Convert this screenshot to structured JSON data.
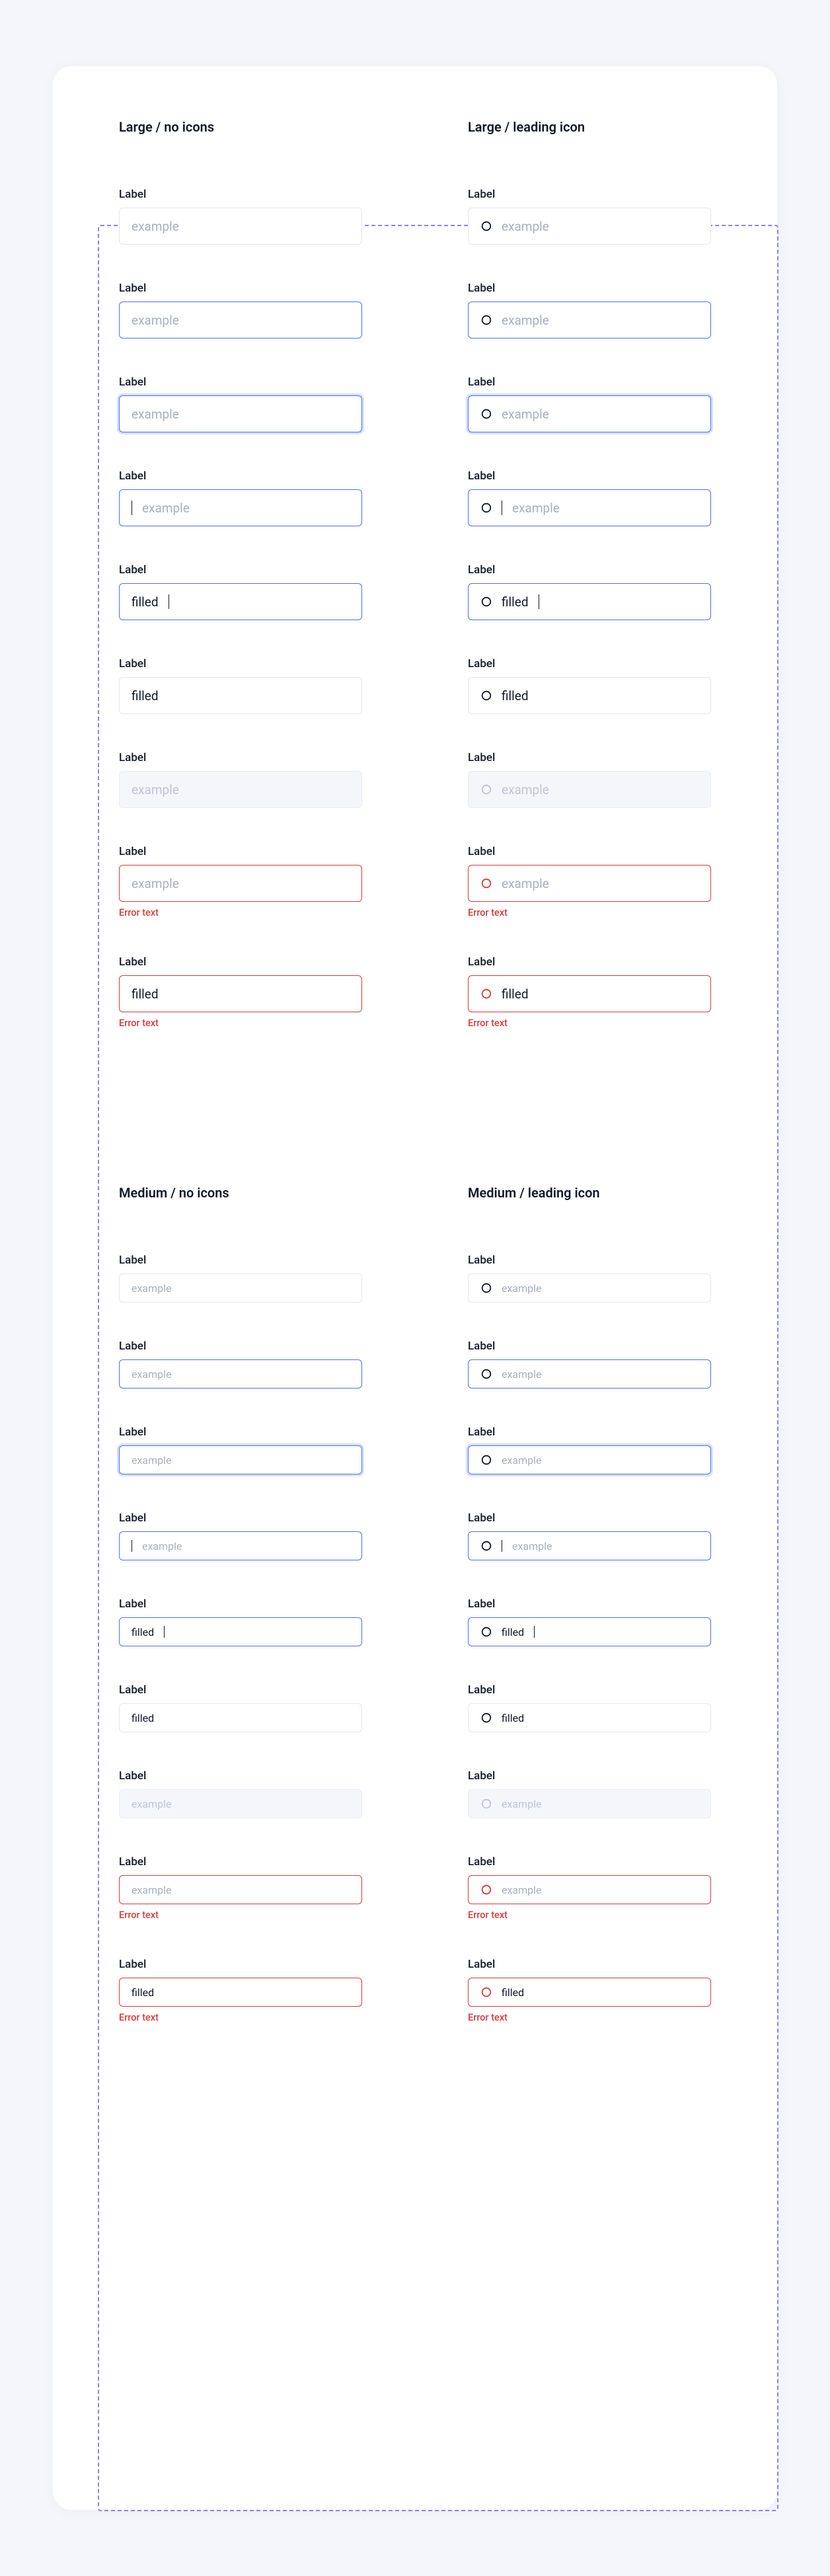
{
  "groups": [
    {
      "size": "large",
      "columns": [
        {
          "heading": "Large / no icons",
          "leading_icon": false
        },
        {
          "heading": "Large / leading icon",
          "leading_icon": true
        }
      ]
    },
    {
      "size": "medium",
      "columns": [
        {
          "heading": "Medium / no icons",
          "leading_icon": false
        },
        {
          "heading": "Medium / leading icon",
          "leading_icon": true
        }
      ]
    }
  ],
  "variants": [
    {
      "id": "default",
      "state": "",
      "label": "Label",
      "value": "",
      "placeholder": "example",
      "error": "",
      "interactable": true,
      "caret": ""
    },
    {
      "id": "hover",
      "state": "state-hover",
      "label": "Label",
      "value": "",
      "placeholder": "example",
      "error": "",
      "interactable": true,
      "caret": ""
    },
    {
      "id": "focus-ring",
      "state": "state-focus-ring",
      "label": "Label",
      "value": "",
      "placeholder": "example",
      "error": "",
      "interactable": true,
      "caret": ""
    },
    {
      "id": "focus-typing",
      "state": "state-focus-typing",
      "label": "Label",
      "value": "",
      "placeholder": "example",
      "error": "",
      "interactable": true,
      "caret": "before"
    },
    {
      "id": "typed-focus",
      "state": "state-typed-focus",
      "label": "Label",
      "value": "filled",
      "placeholder": "",
      "error": "",
      "interactable": true,
      "caret": "after"
    },
    {
      "id": "filled",
      "state": "state-filled",
      "label": "Label",
      "value": "filled",
      "placeholder": "",
      "error": "",
      "interactable": true,
      "caret": ""
    },
    {
      "id": "disabled",
      "state": "state-disabled",
      "label": "Label",
      "value": "",
      "placeholder": "example",
      "error": "",
      "interactable": false,
      "caret": ""
    },
    {
      "id": "error-empty",
      "state": "state-error",
      "label": "Label",
      "value": "",
      "placeholder": "example",
      "error": "Error text",
      "interactable": true,
      "caret": ""
    },
    {
      "id": "error-filled",
      "state": "state-error",
      "label": "Label",
      "value": "filled",
      "placeholder": "",
      "error": "Error text",
      "interactable": true,
      "caret": ""
    }
  ],
  "icon_name": "circle-icon"
}
